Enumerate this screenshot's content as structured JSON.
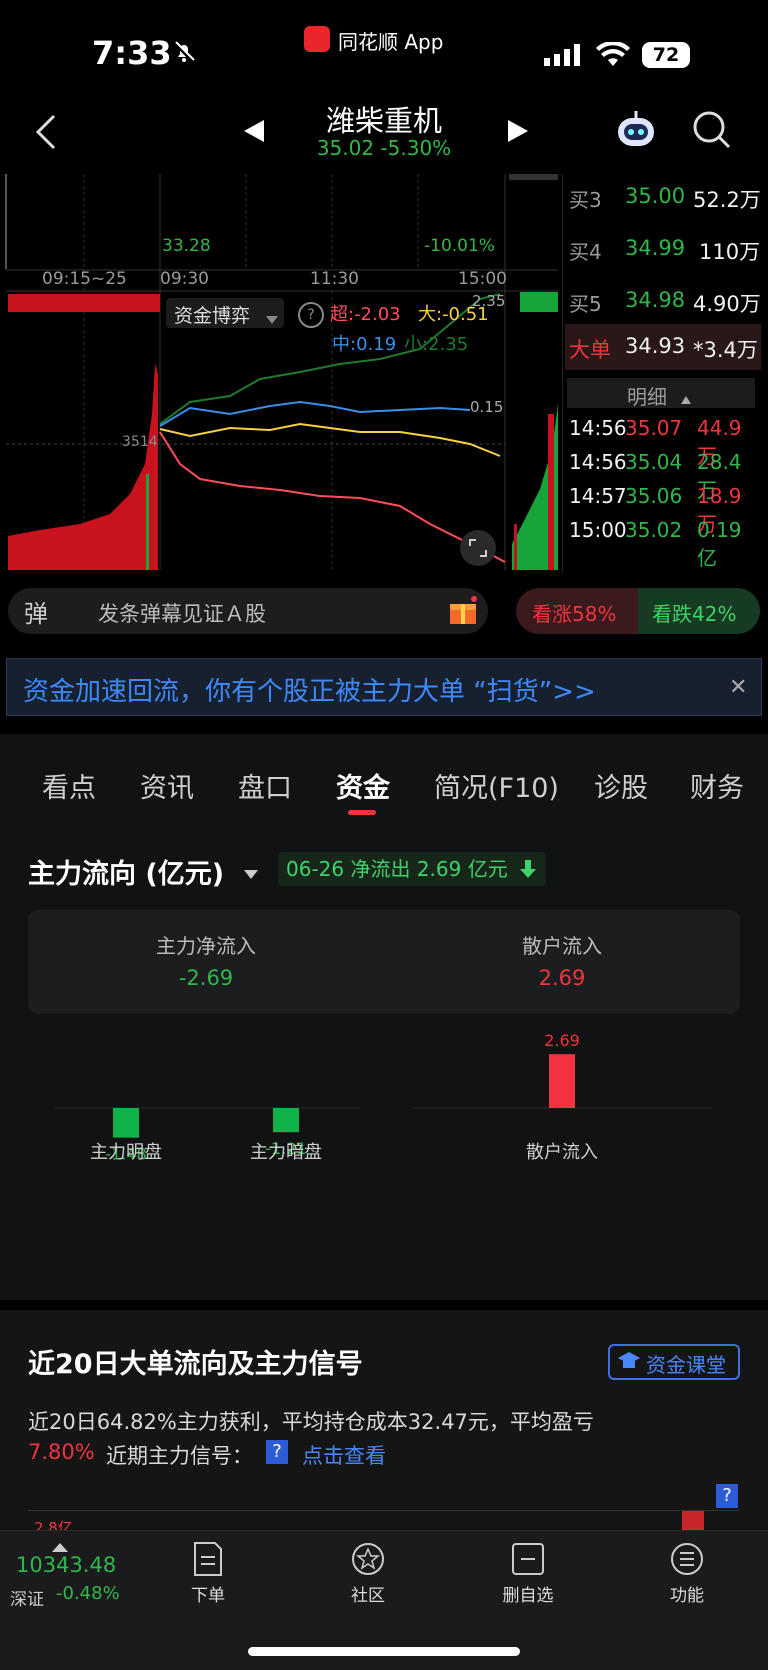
{
  "status_bar": {
    "time": "7:33",
    "app_banner": "同花顺 App",
    "battery": "72"
  },
  "header": {
    "stock_name": "潍柴重机",
    "price_change": "35.02 -5.30%"
  },
  "intraday": {
    "low_label": "33.28",
    "pct_label": "-10.01%",
    "time_labels": [
      "09:15~25",
      "09:30",
      "11:30",
      "15:00"
    ],
    "selector": "资金博弈",
    "legend_super": "超:-2.03",
    "legend_big": "大:-0.51",
    "legend_mid": "中:0.19",
    "legend_small": "小:2.35",
    "label_top_right": "2.35",
    "label_mid_right": "0.15",
    "label_left": "3514",
    "colors": {
      "super": "#ff4d5e",
      "big": "#f5d142",
      "mid": "#3a8ee6",
      "small": "#1f7a2c"
    }
  },
  "orderbook": {
    "rows": [
      {
        "label": "买3",
        "price": "35.00",
        "vol": "52.2万"
      },
      {
        "label": "买4",
        "price": "34.99",
        "vol": "110万"
      },
      {
        "label": "买5",
        "price": "34.98",
        "vol": "4.90万"
      }
    ],
    "big": {
      "label": "大单",
      "price": "34.93",
      "vol": "*3.4万"
    },
    "detail_title": "明细",
    "ticks": [
      {
        "time": "14:56",
        "price": "35.07",
        "vol": "44.9万"
      },
      {
        "time": "14:56",
        "price": "35.04",
        "vol": "28.4万"
      },
      {
        "time": "14:57",
        "price": "35.06",
        "vol": "18.9万"
      },
      {
        "time": "15:00",
        "price": "35.02",
        "vol": "0.19亿"
      }
    ]
  },
  "danmu": {
    "placeholder": "发条弹幕见证Ａ股",
    "bullish": "看涨58%",
    "bearish": "看跌42%",
    "tag": "弹"
  },
  "notice": {
    "text": "资金加速回流，你有个股正被主力大单 “扫货”>>"
  },
  "tabs": [
    "看点",
    "资讯",
    "盘口",
    "资金",
    "简况(F10)",
    "诊股",
    "财务"
  ],
  "active_tab": "资金",
  "main_flow": {
    "title": "主力流向 (亿元)",
    "date_badge": "06-26 净流出 2.69 亿元",
    "net_in_label": "主力净流入",
    "net_in_value": "-2.69",
    "retail_label": "散户流入",
    "retail_value": "2.69"
  },
  "chart_data": {
    "type": "bar",
    "categories": [
      "主力明盘",
      "主力暗盘",
      "散户流入"
    ],
    "values": [
      -1.48,
      -1.21,
      2.69
    ],
    "labels": [
      "-1.48",
      "-1.21",
      "2.69"
    ],
    "colors": [
      "#0fb34a",
      "#0fb34a",
      "#f5323f"
    ],
    "ylim": [
      -3,
      3
    ]
  },
  "signals": {
    "title": "近20日大单流向及主力信号",
    "course_btn": "资金课堂",
    "desc_line1": "近20日64.82%主力获利，平均持仓成本32.47元，平均盈亏",
    "desc_pct": "7.80%",
    "desc_line2": "近期主力信号：",
    "q_mark": "?",
    "link": "点击查看",
    "axis_label": "2.8亿"
  },
  "bottom_bar": {
    "index_value": "10343.48",
    "index_name": "深证",
    "index_change": "-0.48%",
    "items": [
      "下单",
      "社区",
      "删自选",
      "功能"
    ]
  }
}
